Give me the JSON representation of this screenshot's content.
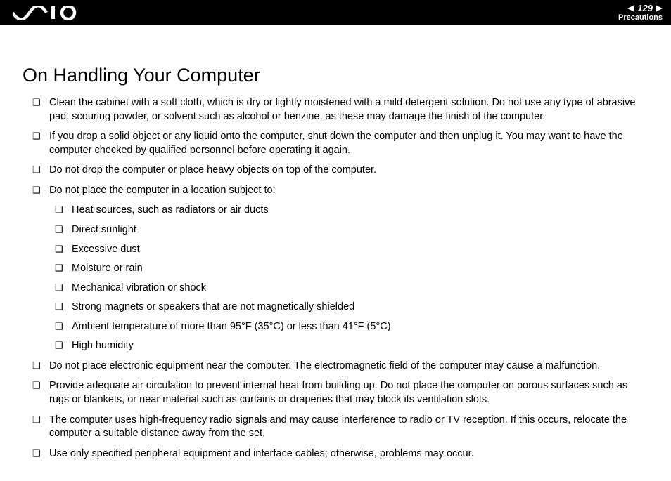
{
  "header": {
    "page_number": "129",
    "section": "Precautions"
  },
  "title": "On Handling Your Computer",
  "items": [
    "Clean the cabinet with a soft cloth, which is dry or lightly moistened with a mild detergent solution. Do not use any type of abrasive pad, scouring powder, or solvent such as alcohol or benzine, as these may damage the finish of the computer.",
    "If you drop a solid object or any liquid onto the computer, shut down the computer and then unplug it. You may want to have the computer checked by qualified personnel before operating it again.",
    "Do not drop the computer or place heavy objects on top of the computer.",
    "Do not place the computer in a location subject to:",
    "Do not place electronic equipment near the computer. The electromagnetic field of the computer may cause a malfunction.",
    "Provide adequate air circulation to prevent internal heat from building up. Do not place the computer on porous surfaces such as rugs or blankets, or near material such as curtains or draperies that may block its ventilation slots.",
    "The computer uses high-frequency radio signals and may cause interference to radio or TV reception. If this occurs, relocate the computer a suitable distance away from the set.",
    "Use only specified peripheral equipment and interface cables; otherwise, problems may occur."
  ],
  "subitems": [
    "Heat sources, such as radiators or air ducts",
    "Direct sunlight",
    "Excessive dust",
    "Moisture or rain",
    "Mechanical vibration or shock",
    "Strong magnets or speakers that are not magnetically shielded",
    "Ambient temperature of more than 95°F (35°C) or less than 41°F (5°C)",
    "High humidity"
  ]
}
